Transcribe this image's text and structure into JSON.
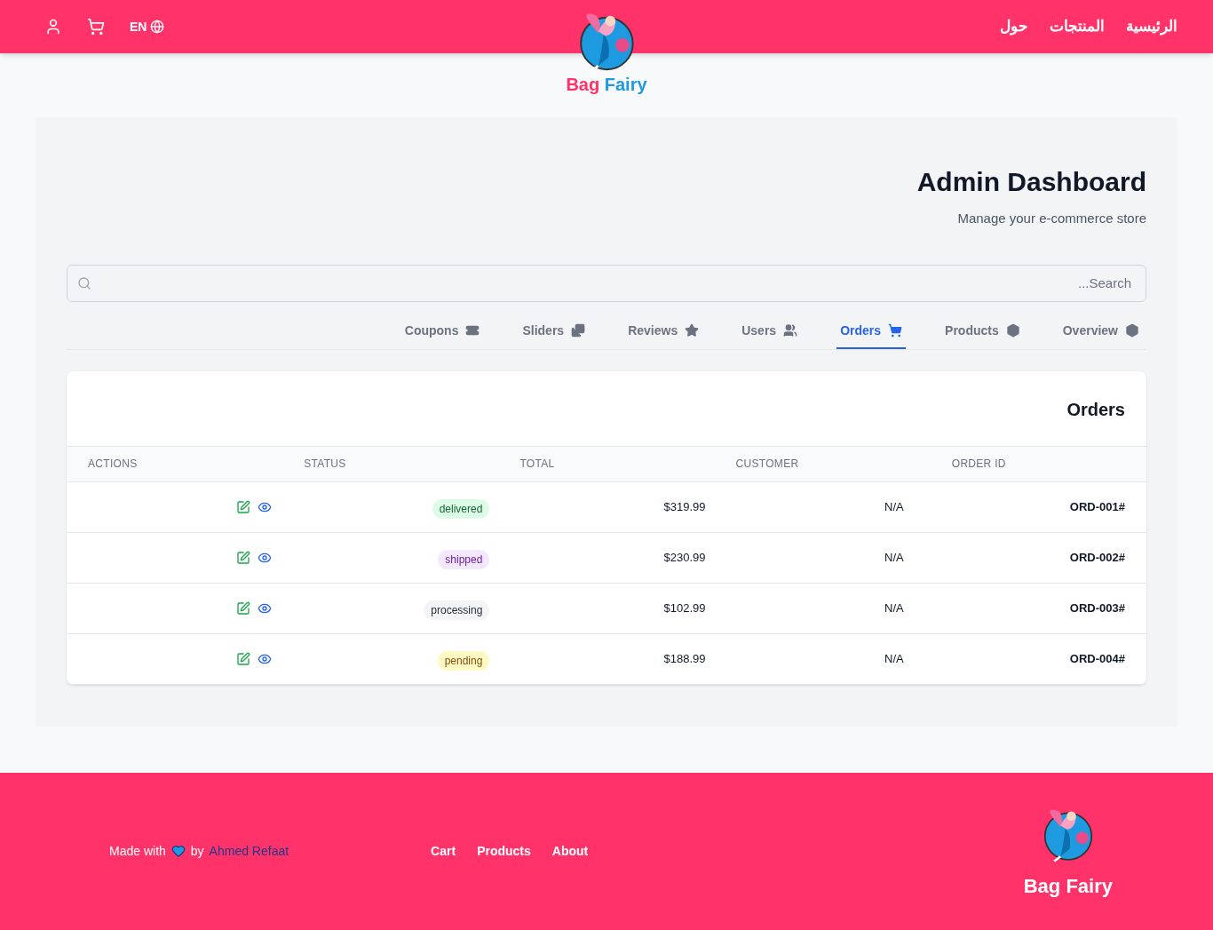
{
  "header": {
    "nav": [
      "الرئيسية",
      "المنتجات",
      "حول"
    ],
    "language": "EN",
    "brand": [
      "Bag",
      "Fairy"
    ]
  },
  "dashboard": {
    "title": "Admin Dashboard",
    "subtitle": "Manage your e-commerce store",
    "search": {
      "placeholder": "...Search"
    }
  },
  "tabs": [
    {
      "label": "Coupons",
      "selected": false
    },
    {
      "label": "Sliders",
      "selected": false
    },
    {
      "label": "Reviews",
      "selected": false
    },
    {
      "label": "Users",
      "selected": false
    },
    {
      "label": "Orders",
      "selected": true
    },
    {
      "label": "Products",
      "selected": false
    },
    {
      "label": "Overview",
      "selected": false
    }
  ],
  "orders": {
    "title": "Orders",
    "columns": [
      "ACTIONS",
      "STATUS",
      "TOTAL",
      "CUSTOMER",
      "ORDER ID"
    ],
    "rows": [
      {
        "id": "ORD-001#",
        "customer": "N/A",
        "total": "$319.99",
        "status": "delivered",
        "kind": "delivered"
      },
      {
        "id": "ORD-002#",
        "customer": "N/A",
        "total": "$230.99",
        "status": "shipped",
        "kind": "shipped"
      },
      {
        "id": "ORD-003#",
        "customer": "N/A",
        "total": "$102.99",
        "status": "processing",
        "kind": "processing"
      },
      {
        "id": "ORD-004#",
        "customer": "N/A",
        "total": "$188.99",
        "status": "pending",
        "kind": "pending"
      }
    ]
  },
  "footer": {
    "made_with": "Made with",
    "by": "by",
    "author": "Ahmed Refaat",
    "links": [
      "Cart",
      "Products",
      "About"
    ],
    "brand": "Bag Fairy"
  }
}
